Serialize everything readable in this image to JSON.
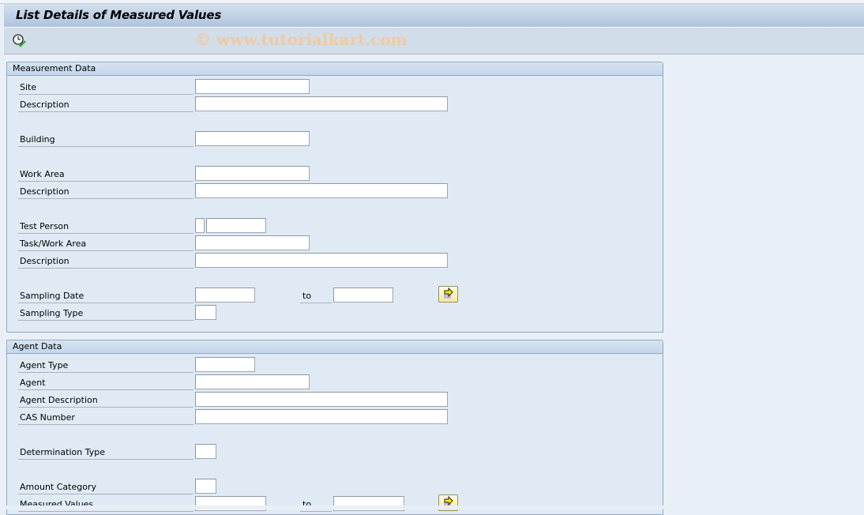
{
  "window": {
    "title": "List Details of Measured Values",
    "watermark": "© www.tutorialkart.com"
  },
  "toolbar": {
    "execute_icon": "execute-clock-check-icon"
  },
  "measurement_group": {
    "title": "Measurement Data",
    "fields": {
      "site": {
        "label": "Site",
        "value": ""
      },
      "site_description": {
        "label": "Description",
        "value": ""
      },
      "building": {
        "label": "Building",
        "value": ""
      },
      "work_area": {
        "label": "Work Area",
        "value": ""
      },
      "work_area_description": {
        "label": "Description",
        "value": ""
      },
      "test_person": {
        "label": "Test Person",
        "value_prefix": "",
        "value": ""
      },
      "task_work_area": {
        "label": "Task/Work Area",
        "value": ""
      },
      "task_description": {
        "label": "Description",
        "value": ""
      },
      "sampling_date": {
        "label": "Sampling Date",
        "from": "",
        "to_label": "to",
        "to": "",
        "multi_icon": "multiple-selection-arrow-icon"
      },
      "sampling_type": {
        "label": "Sampling Type",
        "value": ""
      }
    }
  },
  "agent_group": {
    "title": "Agent Data",
    "fields": {
      "agent_type": {
        "label": "Agent Type",
        "value": ""
      },
      "agent": {
        "label": "Agent",
        "value": ""
      },
      "agent_description": {
        "label": "Agent Description",
        "value": ""
      },
      "cas_number": {
        "label": "CAS Number",
        "value": ""
      },
      "determination_type": {
        "label": "Determination Type",
        "value": ""
      },
      "amount_category": {
        "label": "Amount Category",
        "value": ""
      },
      "measured_values": {
        "label": "Measured Values",
        "from": "",
        "to_label": "to",
        "to": "",
        "multi_icon": "multiple-selection-arrow-icon"
      }
    }
  },
  "colors": {
    "background": "#e9eff7",
    "group_background": "#dfeaf4",
    "multi_button": "#f4e9a8",
    "arrow_yellow": "#ffe800"
  }
}
